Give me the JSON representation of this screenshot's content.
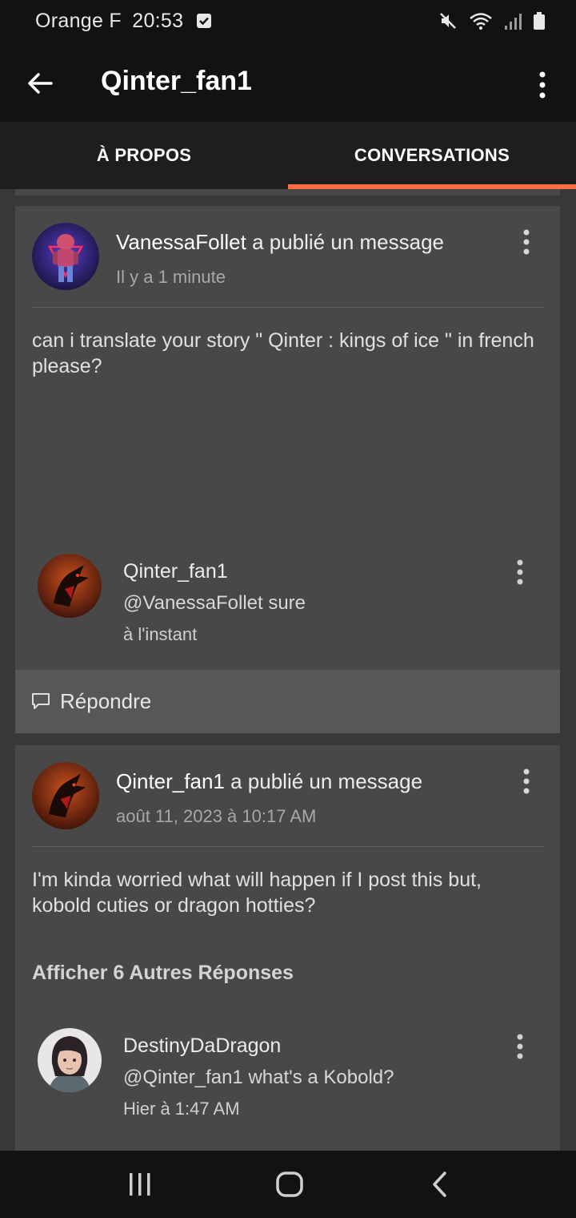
{
  "status_bar": {
    "carrier": "Orange F",
    "time": "20:53"
  },
  "header": {
    "title": "Qinter_fan1"
  },
  "tabs": [
    {
      "label": "À PROPOS",
      "active": false
    },
    {
      "label": "CONVERSATIONS",
      "active": true
    }
  ],
  "colors": {
    "accent": "#ff6e40",
    "background": "#383838",
    "card": "#484848",
    "bar": "#121212"
  },
  "posts": [
    {
      "author": "VanessaFollet",
      "action": " a publié un message",
      "time": "Il y a 1 minute",
      "body": "can i translate your story \" Qinter : kings of ice \" in french please?",
      "replies": [
        {
          "name": "Qinter_fan1",
          "text": "@VanessaFollet sure",
          "time": "à l'instant"
        }
      ],
      "reply_label": "Répondre"
    },
    {
      "author": "Qinter_fan1",
      "action": " a publié un message",
      "time": "août 11, 2023 à 10:17 AM",
      "body": "I'm kinda worried what will happen if I post this but, kobold cuties or dragon hotties?",
      "more_replies": "Afficher 6 Autres Réponses",
      "replies": [
        {
          "name": "DestinyDaDragon",
          "text": "@Qinter_fan1 what's a Kobold?",
          "time": "Hier à 1:47 AM"
        }
      ]
    }
  ],
  "icons": {
    "back": "arrow-left-icon",
    "menu": "more-vert-icon",
    "reply": "comment-icon",
    "nav_recents": "recents-icon",
    "nav_home": "home-icon",
    "nav_back": "nav-back-icon"
  }
}
